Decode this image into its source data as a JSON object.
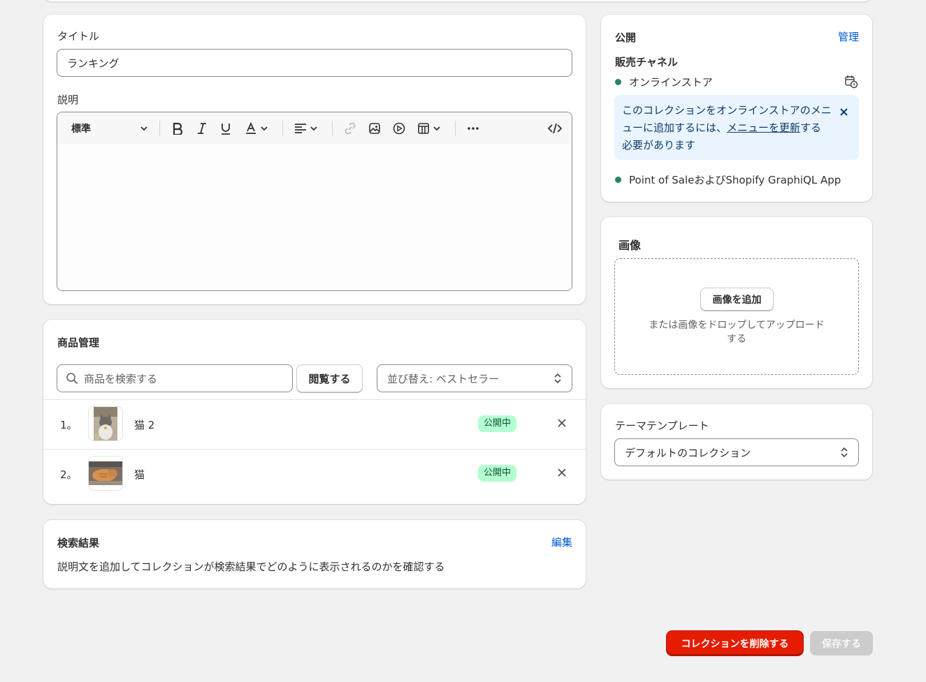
{
  "title_card": {
    "title_label": "タイトル",
    "title_value": "ランキング",
    "description_label": "説明",
    "format_select": "標準"
  },
  "products": {
    "heading": "商品管理",
    "search_placeholder": "商品を検索する",
    "browse_button": "閲覧する",
    "sort_select": "並び替え: ベストセラー",
    "items": [
      {
        "index": "1。",
        "name": "猫 2",
        "status": "公開中"
      },
      {
        "index": "2。",
        "name": "猫",
        "status": "公開中"
      }
    ]
  },
  "seo": {
    "heading": "検索結果",
    "edit_link": "編集",
    "description": "説明文を追加してコレクションが検索結果でどのように表示されるのかを確認する"
  },
  "publishing": {
    "heading": "公開",
    "manage_link": "管理",
    "channels_heading": "販売チャネル",
    "online_store": "オンラインストア",
    "banner_text_before": "このコレクションをオンラインストアのメニューに追加するには、",
    "banner_link": "メニューを更新",
    "banner_text_after": "する必要があります",
    "pos_channel": "Point of SaleおよびShopify GraphiQL App"
  },
  "image": {
    "heading": "画像",
    "add_button": "画像を追加",
    "drop_hint": "または画像をドロップしてアップロードする"
  },
  "theme": {
    "heading": "テーマテンプレート",
    "template_select": "デフォルトのコレクション"
  },
  "footer": {
    "delete_button": "コレクションを削除する",
    "save_button": "保存する"
  },
  "colors": {
    "accent_link": "#005bd3",
    "status_green": "#29845a",
    "badge_bg": "#b4fed2",
    "delete_bg": "#e51c00",
    "banner_bg": "#eaf4ff"
  }
}
